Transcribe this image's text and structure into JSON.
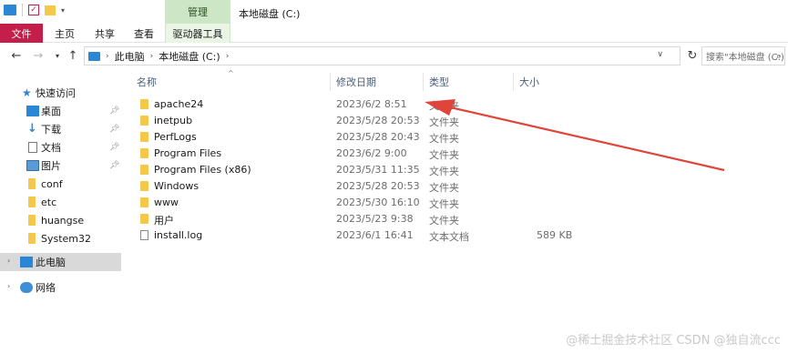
{
  "window": {
    "title": "本地磁盘 (C:)",
    "context_tab": "管理"
  },
  "ribbon": {
    "tabs": [
      "文件",
      "主页",
      "共享",
      "查看",
      "驱动器工具"
    ]
  },
  "address": {
    "crumbs": [
      "此电脑",
      "本地磁盘 (C:)"
    ],
    "search_placeholder": "搜索\"本地磁盘 (C:)\""
  },
  "sidebar": {
    "quick_access": "快速访问",
    "pinned": [
      {
        "label": "桌面",
        "icon": "desktop-icon"
      },
      {
        "label": "下载",
        "icon": "download-icon"
      },
      {
        "label": "文档",
        "icon": "document-icon"
      },
      {
        "label": "图片",
        "icon": "pictures-icon"
      }
    ],
    "folders": [
      "conf",
      "etc",
      "huangse",
      "System32"
    ],
    "this_pc": "此电脑",
    "network": "网络"
  },
  "columns": {
    "name": "名称",
    "date": "修改日期",
    "type": "类型",
    "size": "大小"
  },
  "files": [
    {
      "name": "apache24",
      "date": "2023/6/2 8:51",
      "type": "文件夹",
      "size": "",
      "kind": "folder"
    },
    {
      "name": "inetpub",
      "date": "2023/5/28 20:53",
      "type": "文件夹",
      "size": "",
      "kind": "folder"
    },
    {
      "name": "PerfLogs",
      "date": "2023/5/28 20:43",
      "type": "文件夹",
      "size": "",
      "kind": "folder"
    },
    {
      "name": "Program Files",
      "date": "2023/6/2 9:00",
      "type": "文件夹",
      "size": "",
      "kind": "folder"
    },
    {
      "name": "Program Files (x86)",
      "date": "2023/5/31 11:35",
      "type": "文件夹",
      "size": "",
      "kind": "folder"
    },
    {
      "name": "Windows",
      "date": "2023/5/28 20:53",
      "type": "文件夹",
      "size": "",
      "kind": "folder"
    },
    {
      "name": "www",
      "date": "2023/5/30 16:10",
      "type": "文件夹",
      "size": "",
      "kind": "folder"
    },
    {
      "name": "用户",
      "date": "2023/5/23 9:38",
      "type": "文件夹",
      "size": "",
      "kind": "folder"
    },
    {
      "name": "install.log",
      "date": "2023/6/1 16:41",
      "type": "文本文档",
      "size": "589 KB",
      "kind": "file"
    }
  ],
  "watermark": "@稀土掘金技术社区 CSDN @独自流ccc",
  "colors": {
    "file_tab": "#c41f4b",
    "manage_tab": "#cde6c6",
    "arrow": "#e0443a",
    "folder": "#f5c84c"
  }
}
